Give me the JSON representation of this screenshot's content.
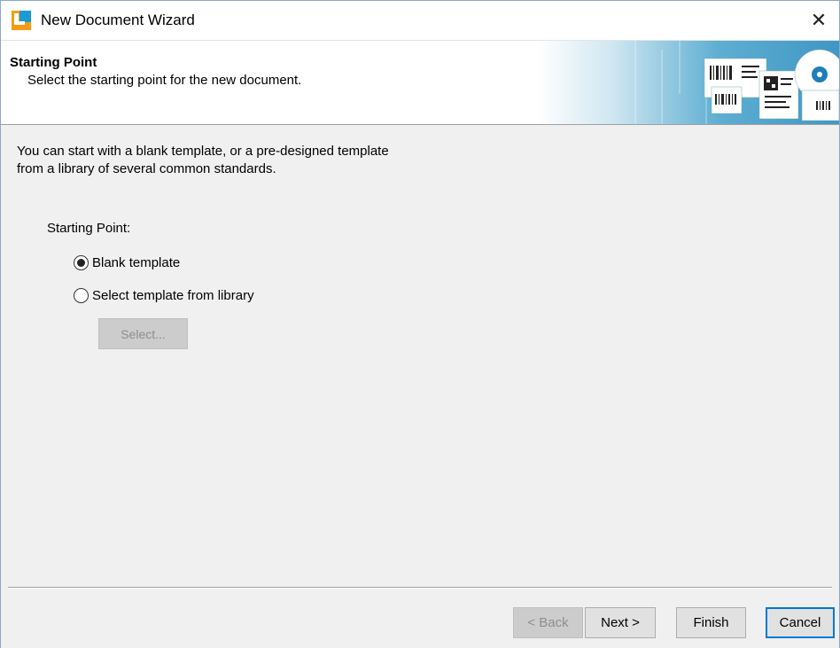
{
  "window": {
    "title": "New Document Wizard",
    "close_glyph": "✕"
  },
  "header": {
    "title": "Starting Point",
    "subtitle": "Select the starting point for the new document."
  },
  "content": {
    "intro": "You can start with a blank template, or a pre-designed template\nfrom a library of several common standards.",
    "section_label": "Starting Point:",
    "options": [
      {
        "label": "Blank template",
        "selected": true
      },
      {
        "label": "Select template from library",
        "selected": false
      }
    ],
    "select_button": "Select...",
    "select_button_enabled": false
  },
  "footer": {
    "back_label": "< Back",
    "next_label": "Next >",
    "finish_label": "Finish",
    "cancel_label": "Cancel",
    "back_enabled": false
  },
  "icons": {
    "app": "app-logo-icon",
    "close": "close-icon",
    "banner": "barcode-labels-banner"
  },
  "colors": {
    "accent": "#0078d7",
    "banner_blue": "#4aa0c8",
    "background": "#f0f0f0"
  }
}
